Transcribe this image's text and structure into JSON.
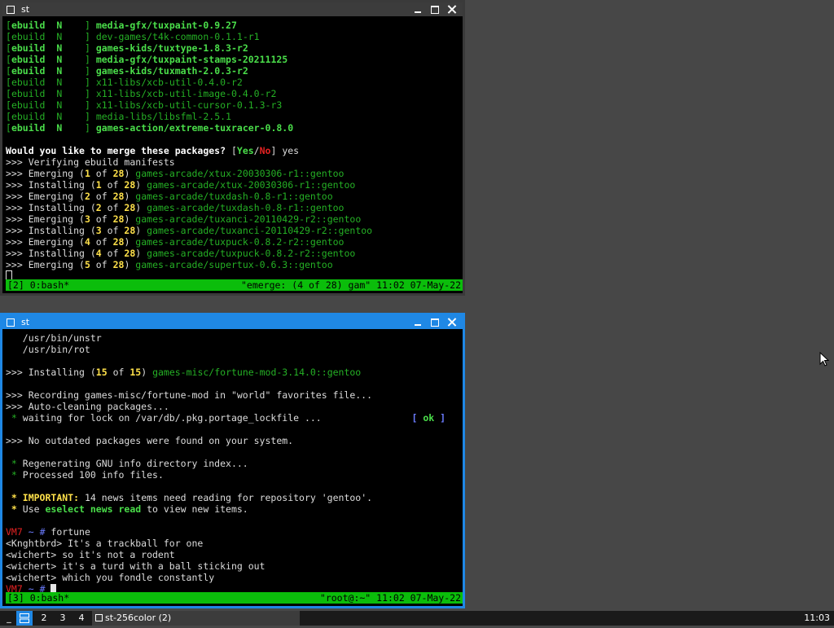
{
  "colors": {
    "window_active_border": "#1f88e5",
    "window_inactive_border": "#3a3a3a",
    "status_bar": "#0bbd0b",
    "terminal_green": "#4ade4a",
    "terminal_dim_green": "#25b025",
    "terminal_yellow": "#ffe14a",
    "terminal_red": "#e52222",
    "terminal_blue": "#6b7cff"
  },
  "windows": {
    "top": {
      "title": "st",
      "status_left": "[2] 0:bash*",
      "status_right": "\"emerge: (4 of 28) gam\" 11:02 07-May-22",
      "lines": [
        [
          {
            "t": "[",
            "c": "#25b025"
          },
          {
            "t": "ebuild  N    ",
            "c": "#4ade4a",
            "b": true
          },
          {
            "t": "] ",
            "c": "#25b025"
          },
          {
            "t": "media-gfx/tuxpaint-0.9.27",
            "c": "#4ade4a",
            "b": true
          }
        ],
        [
          {
            "t": "[",
            "c": "#25b025"
          },
          {
            "t": "ebuild  N    ",
            "c": "#25b025"
          },
          {
            "t": "] ",
            "c": "#25b025"
          },
          {
            "t": "dev-games/t4k-common-0.1.1-r1",
            "c": "#25b025"
          }
        ],
        [
          {
            "t": "[",
            "c": "#25b025"
          },
          {
            "t": "ebuild  N    ",
            "c": "#4ade4a",
            "b": true
          },
          {
            "t": "] ",
            "c": "#25b025"
          },
          {
            "t": "games-kids/tuxtype-1.8.3-r2",
            "c": "#4ade4a",
            "b": true
          }
        ],
        [
          {
            "t": "[",
            "c": "#25b025"
          },
          {
            "t": "ebuild  N    ",
            "c": "#4ade4a",
            "b": true
          },
          {
            "t": "] ",
            "c": "#25b025"
          },
          {
            "t": "media-gfx/tuxpaint-stamps-20211125",
            "c": "#4ade4a",
            "b": true
          }
        ],
        [
          {
            "t": "[",
            "c": "#25b025"
          },
          {
            "t": "ebuild  N    ",
            "c": "#4ade4a",
            "b": true
          },
          {
            "t": "] ",
            "c": "#25b025"
          },
          {
            "t": "games-kids/tuxmath-2.0.3-r2",
            "c": "#4ade4a",
            "b": true
          }
        ],
        [
          {
            "t": "[",
            "c": "#25b025"
          },
          {
            "t": "ebuild  N    ",
            "c": "#25b025"
          },
          {
            "t": "] ",
            "c": "#25b025"
          },
          {
            "t": "x11-libs/xcb-util-0.4.0-r2",
            "c": "#25b025"
          }
        ],
        [
          {
            "t": "[",
            "c": "#25b025"
          },
          {
            "t": "ebuild  N    ",
            "c": "#25b025"
          },
          {
            "t": "] ",
            "c": "#25b025"
          },
          {
            "t": "x11-libs/xcb-util-image-0.4.0-r2",
            "c": "#25b025"
          }
        ],
        [
          {
            "t": "[",
            "c": "#25b025"
          },
          {
            "t": "ebuild  N    ",
            "c": "#25b025"
          },
          {
            "t": "] ",
            "c": "#25b025"
          },
          {
            "t": "x11-libs/xcb-util-cursor-0.1.3-r3",
            "c": "#25b025"
          }
        ],
        [
          {
            "t": "[",
            "c": "#25b025"
          },
          {
            "t": "ebuild  N    ",
            "c": "#25b025"
          },
          {
            "t": "] ",
            "c": "#25b025"
          },
          {
            "t": "media-libs/libsfml-2.5.1",
            "c": "#25b025"
          }
        ],
        [
          {
            "t": "[",
            "c": "#25b025"
          },
          {
            "t": "ebuild  N    ",
            "c": "#4ade4a",
            "b": true
          },
          {
            "t": "] ",
            "c": "#25b025"
          },
          {
            "t": "games-action/extreme-tuxracer-0.8.0",
            "c": "#4ade4a",
            "b": true
          }
        ],
        [],
        [
          {
            "t": "Would you like to merge these packages? ",
            "c": "#ffffff",
            "b": true
          },
          {
            "t": "[",
            "c": "#dcdcdc"
          },
          {
            "t": "Yes",
            "c": "#4ade4a",
            "b": true
          },
          {
            "t": "/",
            "c": "#dcdcdc"
          },
          {
            "t": "No",
            "c": "#e52222",
            "b": true
          },
          {
            "t": "] yes",
            "c": "#dcdcdc"
          }
        ],
        [
          {
            "t": ">>> Verifying ebuild manifests",
            "c": "#dcdcdc"
          }
        ],
        [
          {
            "t": ">>> Emerging (",
            "c": "#dcdcdc"
          },
          {
            "t": "1",
            "c": "#ffe14a",
            "b": true
          },
          {
            "t": " of ",
            "c": "#dcdcdc"
          },
          {
            "t": "28",
            "c": "#ffe14a",
            "b": true
          },
          {
            "t": ") ",
            "c": "#dcdcdc"
          },
          {
            "t": "games-arcade/xtux-20030306-r1::gentoo",
            "c": "#25b025"
          }
        ],
        [
          {
            "t": ">>> Installing (",
            "c": "#dcdcdc"
          },
          {
            "t": "1",
            "c": "#ffe14a",
            "b": true
          },
          {
            "t": " of ",
            "c": "#dcdcdc"
          },
          {
            "t": "28",
            "c": "#ffe14a",
            "b": true
          },
          {
            "t": ") ",
            "c": "#dcdcdc"
          },
          {
            "t": "games-arcade/xtux-20030306-r1::gentoo",
            "c": "#25b025"
          }
        ],
        [
          {
            "t": ">>> Emerging (",
            "c": "#dcdcdc"
          },
          {
            "t": "2",
            "c": "#ffe14a",
            "b": true
          },
          {
            "t": " of ",
            "c": "#dcdcdc"
          },
          {
            "t": "28",
            "c": "#ffe14a",
            "b": true
          },
          {
            "t": ") ",
            "c": "#dcdcdc"
          },
          {
            "t": "games-arcade/tuxdash-0.8-r1::gentoo",
            "c": "#25b025"
          }
        ],
        [
          {
            "t": ">>> Installing (",
            "c": "#dcdcdc"
          },
          {
            "t": "2",
            "c": "#ffe14a",
            "b": true
          },
          {
            "t": " of ",
            "c": "#dcdcdc"
          },
          {
            "t": "28",
            "c": "#ffe14a",
            "b": true
          },
          {
            "t": ") ",
            "c": "#dcdcdc"
          },
          {
            "t": "games-arcade/tuxdash-0.8-r1::gentoo",
            "c": "#25b025"
          }
        ],
        [
          {
            "t": ">>> Emerging (",
            "c": "#dcdcdc"
          },
          {
            "t": "3",
            "c": "#ffe14a",
            "b": true
          },
          {
            "t": " of ",
            "c": "#dcdcdc"
          },
          {
            "t": "28",
            "c": "#ffe14a",
            "b": true
          },
          {
            "t": ") ",
            "c": "#dcdcdc"
          },
          {
            "t": "games-arcade/tuxanci-20110429-r2::gentoo",
            "c": "#25b025"
          }
        ],
        [
          {
            "t": ">>> Installing (",
            "c": "#dcdcdc"
          },
          {
            "t": "3",
            "c": "#ffe14a",
            "b": true
          },
          {
            "t": " of ",
            "c": "#dcdcdc"
          },
          {
            "t": "28",
            "c": "#ffe14a",
            "b": true
          },
          {
            "t": ") ",
            "c": "#dcdcdc"
          },
          {
            "t": "games-arcade/tuxanci-20110429-r2::gentoo",
            "c": "#25b025"
          }
        ],
        [
          {
            "t": ">>> Emerging (",
            "c": "#dcdcdc"
          },
          {
            "t": "4",
            "c": "#ffe14a",
            "b": true
          },
          {
            "t": " of ",
            "c": "#dcdcdc"
          },
          {
            "t": "28",
            "c": "#ffe14a",
            "b": true
          },
          {
            "t": ") ",
            "c": "#dcdcdc"
          },
          {
            "t": "games-arcade/tuxpuck-0.8.2-r2::gentoo",
            "c": "#25b025"
          }
        ],
        [
          {
            "t": ">>> Installing (",
            "c": "#dcdcdc"
          },
          {
            "t": "4",
            "c": "#ffe14a",
            "b": true
          },
          {
            "t": " of ",
            "c": "#dcdcdc"
          },
          {
            "t": "28",
            "c": "#ffe14a",
            "b": true
          },
          {
            "t": ") ",
            "c": "#dcdcdc"
          },
          {
            "t": "games-arcade/tuxpuck-0.8.2-r2::gentoo",
            "c": "#25b025"
          }
        ],
        [
          {
            "t": ">>> Emerging (",
            "c": "#dcdcdc"
          },
          {
            "t": "5",
            "c": "#ffe14a",
            "b": true
          },
          {
            "t": " of ",
            "c": "#dcdcdc"
          },
          {
            "t": "28",
            "c": "#ffe14a",
            "b": true
          },
          {
            "t": ") ",
            "c": "#dcdcdc"
          },
          {
            "t": "games-arcade/supertux-0.6.3::gentoo",
            "c": "#25b025"
          }
        ],
        [
          {
            "cursor": "box"
          }
        ]
      ]
    },
    "bottom": {
      "title": "st",
      "status_left": "[3] 0:bash*",
      "status_right": "\"root@:~\" 11:02 07-May-22",
      "lines": [
        [
          {
            "t": "   /usr/bin/unstr",
            "c": "#dcdcdc"
          }
        ],
        [
          {
            "t": "   /usr/bin/rot",
            "c": "#dcdcdc"
          }
        ],
        [],
        [
          {
            "t": ">>> Installing (",
            "c": "#dcdcdc"
          },
          {
            "t": "15",
            "c": "#ffe14a",
            "b": true
          },
          {
            "t": " of ",
            "c": "#dcdcdc"
          },
          {
            "t": "15",
            "c": "#ffe14a",
            "b": true
          },
          {
            "t": ") ",
            "c": "#dcdcdc"
          },
          {
            "t": "games-misc/fortune-mod-3.14.0::gentoo",
            "c": "#25b025"
          }
        ],
        [],
        [
          {
            "t": ">>> Recording games-misc/fortune-mod in \"world\" favorites file...",
            "c": "#dcdcdc"
          }
        ],
        [
          {
            "t": ">>> Auto-cleaning packages...",
            "c": "#dcdcdc"
          }
        ],
        [
          {
            "t": " * ",
            "c": "#25b025"
          },
          {
            "t": "waiting for lock on /var/db/.pkg.portage_lockfile ...                ",
            "c": "#dcdcdc"
          },
          {
            "t": "[ ",
            "c": "#6b7cff",
            "b": true
          },
          {
            "t": "ok",
            "c": "#4ade4a",
            "b": true
          },
          {
            "t": " ]",
            "c": "#6b7cff",
            "b": true
          }
        ],
        [],
        [
          {
            "t": ">>> No outdated packages were found on your system.",
            "c": "#dcdcdc"
          }
        ],
        [],
        [
          {
            "t": " * ",
            "c": "#25b025"
          },
          {
            "t": "Regenerating GNU info directory index...",
            "c": "#dcdcdc"
          }
        ],
        [
          {
            "t": " * ",
            "c": "#25b025"
          },
          {
            "t": "Processed 100 info files.",
            "c": "#dcdcdc"
          }
        ],
        [],
        [
          {
            "t": " * ",
            "c": "#ffe14a",
            "b": true
          },
          {
            "t": "IMPORTANT:",
            "c": "#ffe14a",
            "b": true
          },
          {
            "t": " 14 news items need reading for repository 'gentoo'.",
            "c": "#dcdcdc"
          }
        ],
        [
          {
            "t": " * ",
            "c": "#ffe14a",
            "b": true
          },
          {
            "t": "Use ",
            "c": "#dcdcdc"
          },
          {
            "t": "eselect news read",
            "c": "#4ade4a",
            "b": true
          },
          {
            "t": " to view new items.",
            "c": "#dcdcdc"
          }
        ],
        [],
        [
          {
            "t": "VM7",
            "c": "#e52222"
          },
          {
            "t": " ~ ",
            "c": "#6b7cff"
          },
          {
            "t": "# ",
            "c": "#6b7cff"
          },
          {
            "t": "fortune",
            "c": "#dcdcdc"
          }
        ],
        [
          {
            "t": "<Knghtbrd> It's a trackball for one",
            "c": "#dcdcdc"
          }
        ],
        [
          {
            "t": "<wichert> so it's not a rodent",
            "c": "#dcdcdc"
          }
        ],
        [
          {
            "t": "<wichert> it's a turd with a ball sticking out",
            "c": "#dcdcdc"
          }
        ],
        [
          {
            "t": "<wichert> which you fondle constantly",
            "c": "#dcdcdc"
          }
        ],
        [
          {
            "t": "VM7",
            "c": "#e52222"
          },
          {
            "t": " ~ ",
            "c": "#6b7cff"
          },
          {
            "t": "# ",
            "c": "#6b7cff"
          },
          {
            "cursor": "solid"
          }
        ]
      ]
    }
  },
  "taskbar": {
    "layout_symbol": "_",
    "workspaces": [
      "2",
      "3",
      "4"
    ],
    "task_label": "st-256color (2)",
    "clock": "11:03"
  }
}
